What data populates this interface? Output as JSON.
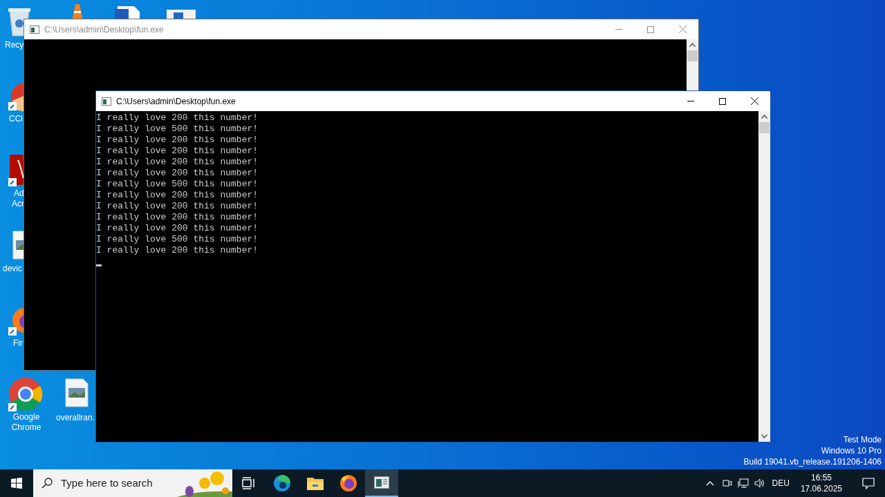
{
  "desktop_icons": [
    {
      "kind": "bin",
      "label_lines": [
        "Recy"
      ]
    },
    {
      "kind": "cleaner",
      "label_lines": [
        "CCl"
      ]
    },
    {
      "kind": "pdf",
      "label_lines": [
        "Ad",
        "Acr"
      ]
    },
    {
      "kind": "image",
      "label_lines": [
        "devic"
      ]
    },
    {
      "kind": "firefox",
      "label_lines": [
        "Fir"
      ]
    },
    {
      "kind": "chrome",
      "label_lines": [
        "Google",
        "Chrome"
      ]
    },
    {
      "kind": "image",
      "label_lines": [
        "overallran."
      ]
    }
  ],
  "windows": [
    {
      "title": "C:\\Users\\admin\\Desktop\\fun.exe",
      "active": false
    },
    {
      "title": "C:\\Users\\admin\\Desktop\\fun.exe",
      "active": true,
      "lines": [
        "I really love 200 this number!",
        "I really love 500 this number!",
        "I really love 200 this number!",
        "I really love 200 this number!",
        "I really love 200 this number!",
        "I really love 200 this number!",
        "I really love 500 this number!",
        "I really love 200 this number!",
        "I really love 200 this number!",
        "I really love 200 this number!",
        "I really love 200 this number!",
        "I really love 500 this number!",
        "I really love 200 this number!"
      ]
    }
  ],
  "system_notice": [
    "Test Mode",
    "Windows 10 Pro",
    "Build 19041.vb_release.191206-1406"
  ],
  "taskbar": {
    "search": {
      "placeholder": "Type here to search"
    },
    "apps": [
      {
        "kind": "taskview",
        "selected": false
      },
      {
        "kind": "edge",
        "selected": false
      },
      {
        "kind": "explorer",
        "selected": false
      },
      {
        "kind": "firefox",
        "selected": false
      },
      {
        "kind": "console",
        "selected": true
      }
    ],
    "language": "DEU",
    "time": "16:55",
    "date": "17.06.2025"
  }
}
